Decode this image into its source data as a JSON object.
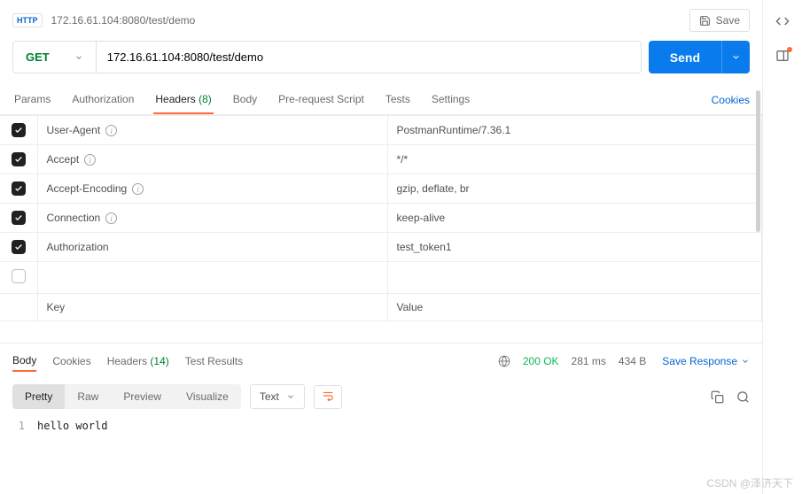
{
  "top": {
    "http_badge": "HTTP",
    "breadcrumb": "172.16.61.104:8080/test/demo",
    "save_label": "Save"
  },
  "request": {
    "method": "GET",
    "url": "172.16.61.104:8080/test/demo",
    "send_label": "Send"
  },
  "req_tabs": {
    "params": "Params",
    "authorization": "Authorization",
    "headers": "Headers",
    "headers_count": "(8)",
    "body": "Body",
    "prerequest": "Pre-request Script",
    "tests": "Tests",
    "settings": "Settings",
    "cookies": "Cookies"
  },
  "headers": [
    {
      "checked": true,
      "key": "User-Agent",
      "info": true,
      "value": "PostmanRuntime/7.36.1"
    },
    {
      "checked": true,
      "key": "Accept",
      "info": true,
      "value": "*/*"
    },
    {
      "checked": true,
      "key": "Accept-Encoding",
      "info": true,
      "value": "gzip, deflate, br"
    },
    {
      "checked": true,
      "key": "Connection",
      "info": true,
      "value": "keep-alive"
    },
    {
      "checked": true,
      "key": "Authorization",
      "info": false,
      "value": "test_token1"
    },
    {
      "checked": false,
      "key": "",
      "info": false,
      "value": ""
    }
  ],
  "headers_placeholder": {
    "key": "Key",
    "value": "Value"
  },
  "response": {
    "tabs": {
      "body": "Body",
      "cookies": "Cookies",
      "headers": "Headers",
      "headers_count": "(14)",
      "tests": "Test Results"
    },
    "status_code": "200 OK",
    "time": "281 ms",
    "size": "434 B",
    "save_label": "Save Response",
    "view": {
      "pretty": "Pretty",
      "raw": "Raw",
      "preview": "Preview",
      "visualize": "Visualize",
      "fmt": "Text"
    },
    "lines": [
      {
        "n": "1",
        "text": "hello world"
      }
    ]
  },
  "watermark": "CSDN @泽济天下"
}
